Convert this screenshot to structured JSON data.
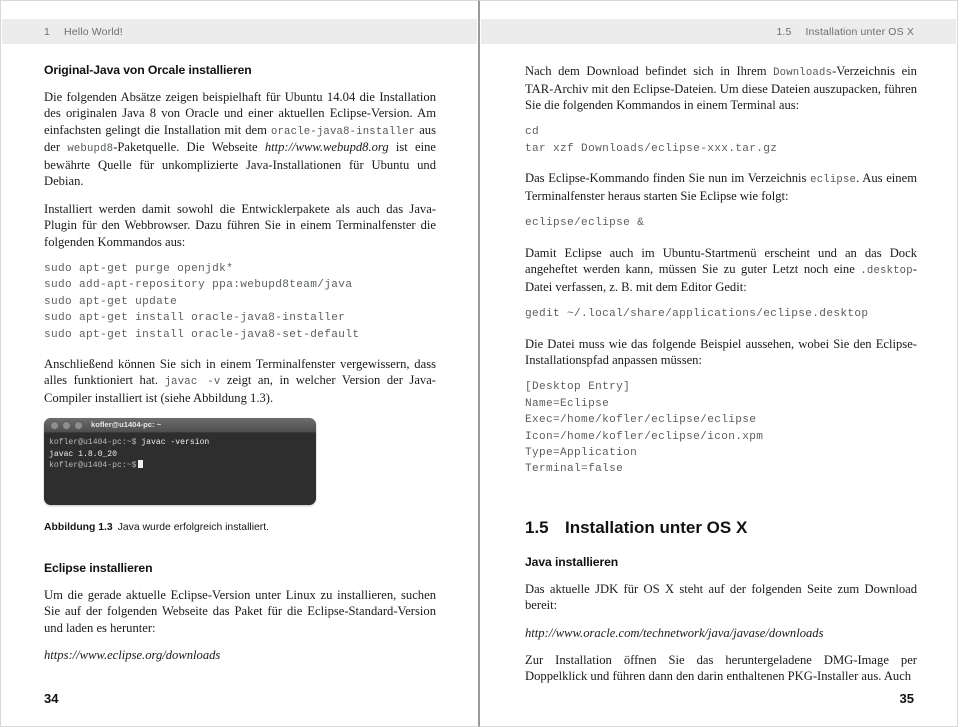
{
  "left_page": {
    "running_head": {
      "number": "1",
      "title": "Hello World!"
    },
    "folio": "34",
    "heading_1": "Original-Java von Orcale installieren",
    "para_1_a": "Die folgenden Absätze zeigen beispielhaft für Ubuntu 14.04 die Installation des originalen Java 8 von Oracle und einer aktuellen Eclipse-Version. Am einfachsten gelingt die Installation mit dem ",
    "para_1_code_1": "oracle-java8-installer",
    "para_1_b": " aus der ",
    "para_1_code_2": "webupd8",
    "para_1_c": "-Paketquelle. Die Webseite ",
    "para_1_url": "http://www.webupd8.org",
    "para_1_d": " ist eine bewährte Quelle für unkomplizierte Java-Installationen für Ubuntu und Debian.",
    "para_2": "Installiert werden damit sowohl die Entwicklerpakete als auch das Java-Plugin für den Webbrowser. Dazu führen Sie in einem Terminalfenster die folgenden Kommandos aus:",
    "code_block_1": "sudo apt-get purge openjdk*\nsudo add-apt-repository ppa:webupd8team/java\nsudo apt-get update\nsudo apt-get install oracle-java8-installer\nsudo apt-get install oracle-java8-set-default",
    "para_3_a": "Anschließend können Sie sich in einem Terminalfenster vergewissern, dass alles funktioniert hat. ",
    "para_3_code": "javac -v",
    "para_3_b": " zeigt an, in welcher Version der Java-Compiler installiert ist (siehe Abbildung 1.3).",
    "terminal": {
      "title": "kofler@u1404-pc: ~",
      "line_1_prompt": "kofler@u1404-pc:~$",
      "line_1_cmd": " javac -version",
      "line_2": "javac 1.8.0_20",
      "line_3_prompt": "kofler@u1404-pc:~$"
    },
    "figure_caption_label": "Abbildung 1.3",
    "figure_caption_text": "Java wurde erfolgreich installiert.",
    "heading_2": "Eclipse installieren",
    "para_4": "Um die gerade aktuelle Eclipse-Version unter Linux zu installieren, suchen Sie auf der folgenden Webseite das Paket für die Eclipse-Standard-Version und laden es herunter:",
    "url_1": "https://www.eclipse.org/downloads"
  },
  "right_page": {
    "running_head": {
      "number": "1.5",
      "title": "Installation unter OS X"
    },
    "folio": "35",
    "para_1_a": "Nach dem Download befindet sich in Ihrem ",
    "para_1_code": "Downloads",
    "para_1_b": "-Verzeichnis ein TAR-Archiv mit den Eclipse-Dateien. Um diese Dateien auszupacken, führen Sie die folgenden Kommandos in einem Terminal aus:",
    "code_block_1": "cd\ntar xzf Downloads/eclipse-xxx.tar.gz",
    "para_2_a": "Das Eclipse-Kommando finden Sie nun im Verzeichnis ",
    "para_2_code": "eclipse",
    "para_2_b": ". Aus einem Terminalfenster heraus starten Sie Eclipse wie folgt:",
    "code_block_2": "eclipse/eclipse &",
    "para_3_a": "Damit Eclipse auch im Ubuntu-Startmenü erscheint und an das Dock angeheftet werden kann, müssen Sie zu guter Letzt noch eine ",
    "para_3_code": ".desktop",
    "para_3_b": "-Datei verfassen, z. B. mit dem Editor Gedit:",
    "code_block_3": "gedit ~/.local/share/applications/eclipse.desktop",
    "para_4": "Die Datei muss wie das folgende Beispiel aussehen, wobei Sie den Eclipse-Installationspfad anpassen müssen:",
    "code_block_4": "[Desktop Entry]\nName=Eclipse\nExec=/home/kofler/eclipse/eclipse\nIcon=/home/kofler/eclipse/icon.xpm\nType=Application\nTerminal=false",
    "section_number": "1.5",
    "section_title": "Installation unter OS X",
    "heading_1": "Java installieren",
    "para_5": "Das aktuelle JDK für OS X steht auf der folgenden Seite zum Download bereit:",
    "url_1": "http://www.oracle.com/technetwork/java/javase/downloads",
    "para_6": "Zur Installation öffnen Sie das heruntergeladene DMG-Image per Doppelklick und führen dann den darin enthaltenen PKG-Installer aus. Auch"
  },
  "colors": {
    "header_band": "#ececec",
    "header_text": "#6e6e6e",
    "code_text": "#5a5e61",
    "terminal_bg": "#2e2e2e",
    "page_bg": "#ffffff"
  }
}
